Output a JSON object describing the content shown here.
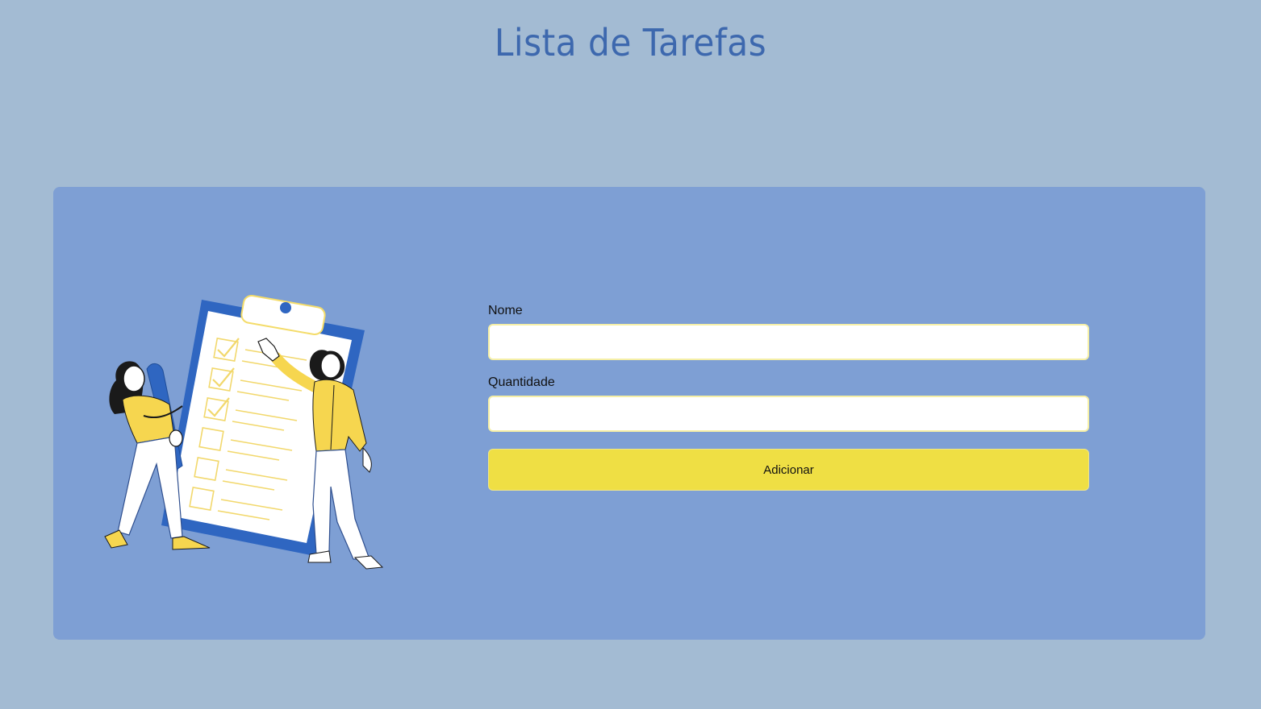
{
  "header": {
    "title": "Lista de Tarefas"
  },
  "form": {
    "name_label": "Nome",
    "name_value": "",
    "quantity_label": "Quantidade",
    "quantity_value": "",
    "submit_label": "Adicionar"
  },
  "illustration": {
    "icon": "two-people-with-clipboard-checklist-illustration"
  },
  "colors": {
    "background": "#a3bbd3",
    "card": "#7e9fd4",
    "title": "#3d68ae",
    "button": "#efdf44",
    "input_border": "#f5efa6"
  }
}
